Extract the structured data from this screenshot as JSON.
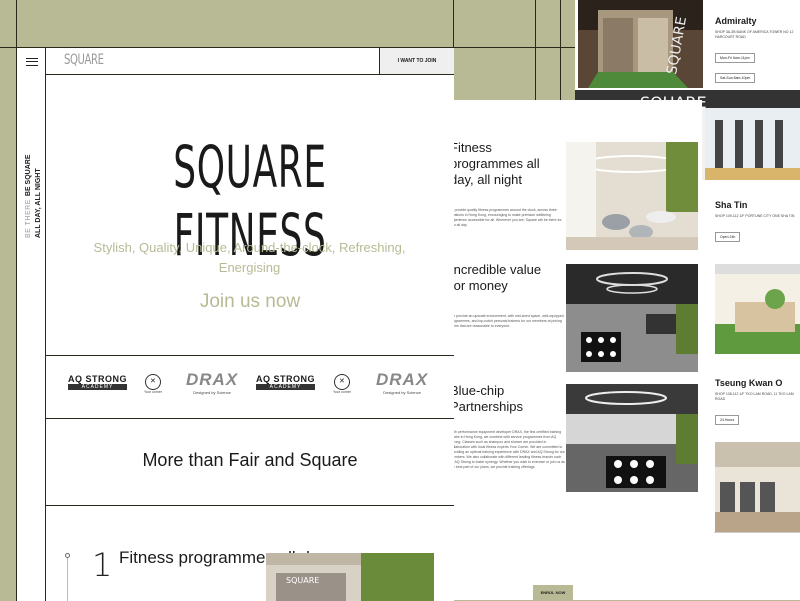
{
  "locations": [
    {
      "name": "Admiralty",
      "address": "SHOP 3A-3B BANK OF AMERICA TOWER NO 12 HARCOURT ROAD",
      "hours": [
        "Mon-Fri 6am-11pm",
        "Sat-Sun 8am-10pm"
      ]
    },
    {
      "name": "Sha Tin",
      "address": "SHOP 109-112 1/F PORTUNE CITY ONE SHA TIN",
      "hours": [
        "Open 24h"
      ]
    },
    {
      "name": "Tseung Kwan O",
      "address": "SHOP 108-112 1/F TKO LAM ROAD, 11 TKO LAM ROAD",
      "hours": [
        "24 Hours"
      ]
    }
  ],
  "features": [
    {
      "heading": "Fitness programmes all day, all night",
      "body": "To provide quality fitness programmes around the clock, across three locations in Hong Kong, encouraging to make premium wellbeing experience accessible for all. Wherever you are, Square will be there for you all day."
    },
    {
      "heading": "Incredible value for money",
      "body": "We provide an upscale environment, with mid-sized space, well-equipped programmes, and top-notch personal trainers for our members at pricing terms that are reasonable to everyone."
    },
    {
      "heading": "Blue-chip Partnerships",
      "body": "With performance equipment developer DRAX, the first certified training centre in Hong Kong, we combine with service programmes from AQ Strong. Classes such as shampoo and shower are provided in collaboration with local fitness experts Your Corner. We are committed to providing an optimal training experience with DRAX and AQ Strong for our members. We also collaborate with different leading fitness brands such as AQ Strong to foster synergy. Whether you wish to exercise or join us as the best part of our plans, we provide training offerings."
    }
  ],
  "enrol_label": "ENROL NOW",
  "nav": {
    "logo": "SQUARE",
    "join_label": "I WANT TO JOIN"
  },
  "side": {
    "text1": "BE THERE",
    "text2": "BE SQUARE",
    "text3": "ALL DAY, ALL NIGHT"
  },
  "hero": {
    "title": "SQUARE FITNESS",
    "tagline": "Stylish, Quality, Unique, Around-the-clock, Refreshing, Energising",
    "cta": "Join us now"
  },
  "partners": [
    {
      "kind": "aq",
      "title": "AQ STRONG",
      "sub": "ACADEMY"
    },
    {
      "kind": "sc",
      "sub": "Your corner"
    },
    {
      "kind": "drax",
      "title": "DRAX",
      "sub": "Designed by Science"
    },
    {
      "kind": "aq",
      "title": "AQ STRONG",
      "sub": "ACADEMY"
    },
    {
      "kind": "sc",
      "sub": "Your corner"
    },
    {
      "kind": "drax",
      "title": "DRAX",
      "sub": "Designed by Science"
    }
  ],
  "section_title": "More than Fair and Square",
  "programme": {
    "number": "1",
    "title": "Fitness programmes all day"
  },
  "colors": {
    "accent": "#b8ba95",
    "dark": "#1a1a1a"
  }
}
